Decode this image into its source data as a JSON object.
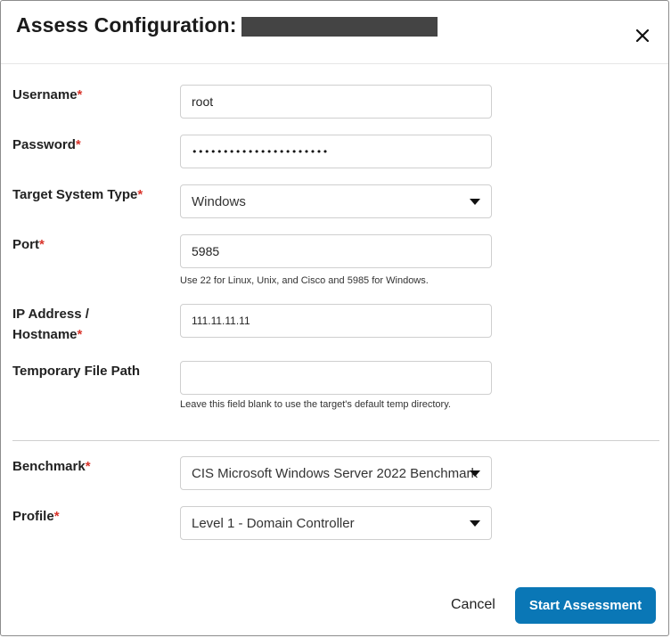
{
  "dialog": {
    "title": "Assess Configuration:",
    "close_icon": "close-icon"
  },
  "form": {
    "username": {
      "label": "Username",
      "required": "*",
      "value": "root"
    },
    "password": {
      "label": "Password",
      "required": "*",
      "value": "••••••••••••••••••••••"
    },
    "target_system_type": {
      "label": "Target System Type",
      "required": "*",
      "value": "Windows"
    },
    "port": {
      "label": "Port",
      "required": "*",
      "value": "5985",
      "hint": "Use 22 for Linux, Unix, and Cisco and 5985 for Windows."
    },
    "ip_address": {
      "label_line1": "IP Address /",
      "label_line2": "Hostname",
      "required": "*",
      "value": "111.11.11.11"
    },
    "temp_path": {
      "label": "Temporary File Path",
      "value": "",
      "hint": "Leave this field blank to use the target's default temp directory."
    },
    "benchmark": {
      "label": "Benchmark",
      "required": "*",
      "value": "CIS Microsoft Windows Server 2022 Benchmark"
    },
    "profile": {
      "label": "Profile",
      "required": "*",
      "value": "Level 1 - Domain Controller"
    }
  },
  "footer": {
    "cancel_label": "Cancel",
    "start_label": "Start Assessment"
  },
  "colors": {
    "primary": "#0a77b6",
    "required": "#d9342b"
  }
}
